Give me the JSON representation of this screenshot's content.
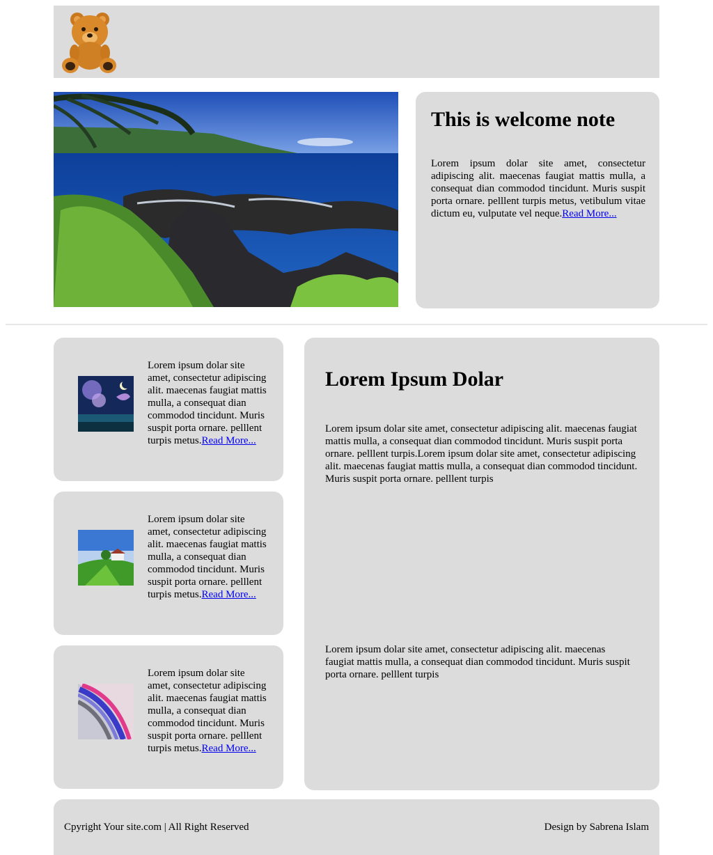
{
  "header": {
    "logo_alt": "teddy-bear-logo"
  },
  "welcome": {
    "title": "This is welcome note",
    "body": "Lorem ipsum dolar site amet, consectetur adipiscing alit. maecenas faugiat mattis mulla, a consequat dian commodod tincidunt. Muris suspit porta ornare. pelllent turpis metus, vetibulum vitae dictum eu, vulputate vel neque.",
    "read_more": "Read More..."
  },
  "cards": [
    {
      "body": "Lorem ipsum dolar site amet, consectetur adipiscing alit. maecenas faugiat mattis mulla, a consequat dian commodod tincidunt. Muris suspit porta ornare. pelllent turpis metus.",
      "read_more": "Read More..."
    },
    {
      "body": "Lorem ipsum dolar site amet, consectetur adipiscing alit. maecenas faugiat mattis mulla, a consequat dian commodod tincidunt. Muris suspit porta ornare. pelllent turpis metus.",
      "read_more": "Read More..."
    },
    {
      "body": "Lorem ipsum dolar site amet, consectetur adipiscing alit. maecenas faugiat mattis mulla, a consequat dian commodod tincidunt. Muris suspit porta ornare. pelllent turpis metus.",
      "read_more": "Read More..."
    }
  ],
  "article": {
    "title": "Lorem Ipsum Dolar",
    "paragraph1": "Lorem ipsum dolar site amet, consectetur adipiscing alit. maecenas faugiat mattis mulla, a consequat dian commodod tincidunt. Muris suspit porta ornare. pelllent turpis.Lorem ipsum dolar site amet, consectetur adipiscing alit. maecenas faugiat mattis mulla, a consequat dian commodod tincidunt. Muris suspit porta ornare. pelllent turpis",
    "paragraph2": "Lorem ipsum dolar site amet, consectetur adipiscing alit. maecenas faugiat mattis mulla, a consequat dian commodod tincidunt. Muris suspit porta ornare. pelllent turpis"
  },
  "footer": {
    "copyright": "Cpyright Your site.com | All Right Reserved",
    "credit": "Design by Sabrena Islam"
  }
}
